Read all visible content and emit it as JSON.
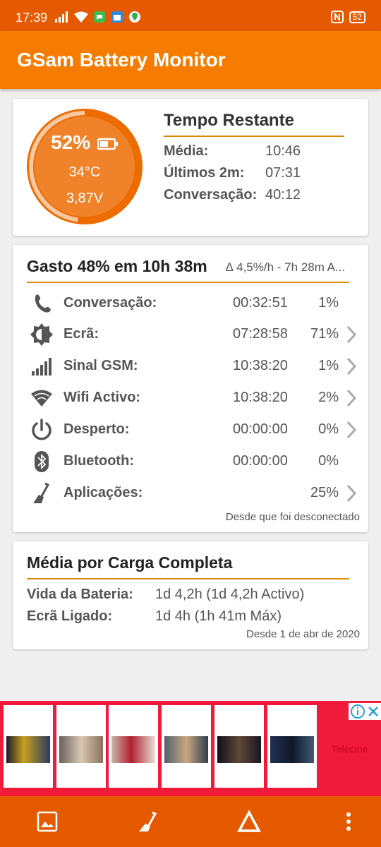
{
  "status_bar": {
    "time": "17:39",
    "battery_level": "52",
    "icons": [
      "signal-icon",
      "wifi-icon",
      "chat-icon",
      "calendar-icon",
      "maps-icon",
      "nfc-icon",
      "battery-icon"
    ]
  },
  "app_bar": {
    "title": "GSam Battery Monitor"
  },
  "battery_ring": {
    "percent_label": "52%",
    "percent_value": 52,
    "temperature": "34°C",
    "voltage": "3,87V"
  },
  "time_remaining": {
    "title": "Tempo Restante",
    "rows": [
      {
        "label": "Média:",
        "value": "10:46"
      },
      {
        "label": "Últimos 2m:",
        "value": "07:31"
      },
      {
        "label": "Conversação:",
        "value": "40:12"
      }
    ]
  },
  "spent": {
    "title": "Gasto 48% em 10h 38m",
    "delta": "∆ 4,5%/h - 7h 28m A...",
    "rows": [
      {
        "icon": "phone-icon",
        "label": "Conversação:",
        "time": "00:32:51",
        "percent": "1%",
        "has_chevron": false
      },
      {
        "icon": "screen-brightness-icon",
        "label": "Ecrã:",
        "time": "07:28:58",
        "percent": "71%",
        "has_chevron": true
      },
      {
        "icon": "signal-bars-icon",
        "label": "Sinal GSM:",
        "time": "10:38:20",
        "percent": "1%",
        "has_chevron": true
      },
      {
        "icon": "wifi-icon",
        "label": "Wifi Activo:",
        "time": "10:38:20",
        "percent": "2%",
        "has_chevron": true
      },
      {
        "icon": "power-icon",
        "label": "Desperto:",
        "time": "00:00:00",
        "percent": "0%",
        "has_chevron": true
      },
      {
        "icon": "bluetooth-icon",
        "label": "Bluetooth:",
        "time": "00:00:00",
        "percent": "0%",
        "has_chevron": false
      },
      {
        "icon": "broom-icon",
        "label": "Aplicações:",
        "time": "",
        "percent": "25%",
        "has_chevron": true
      }
    ],
    "footer": "Desde que foi desconectado"
  },
  "full_charge": {
    "title": "Média por Carga Completa",
    "rows": [
      {
        "label": "Vida da Bateria:",
        "value": "1d 4,2h (1d 4,2h Activo)"
      },
      {
        "label": "Ecrã Ligado:",
        "value": "1d 4h (1h 41m Máx)"
      }
    ],
    "footer": "Desde 1 de abr de 2020"
  },
  "ad_banner": {
    "brand_text": "Telecine"
  },
  "bottom_bar": {
    "buttons": [
      "image-icon",
      "broom-icon",
      "delta-icon",
      "more-vert-icon"
    ]
  },
  "colors": {
    "status_bar": "#e55a00",
    "app_bar": "#f57c00",
    "ring_fill": "#f0822a",
    "ring_track": "#f7c9a3",
    "divider": "#d88a00",
    "ad_bg": "#f01a3a"
  }
}
